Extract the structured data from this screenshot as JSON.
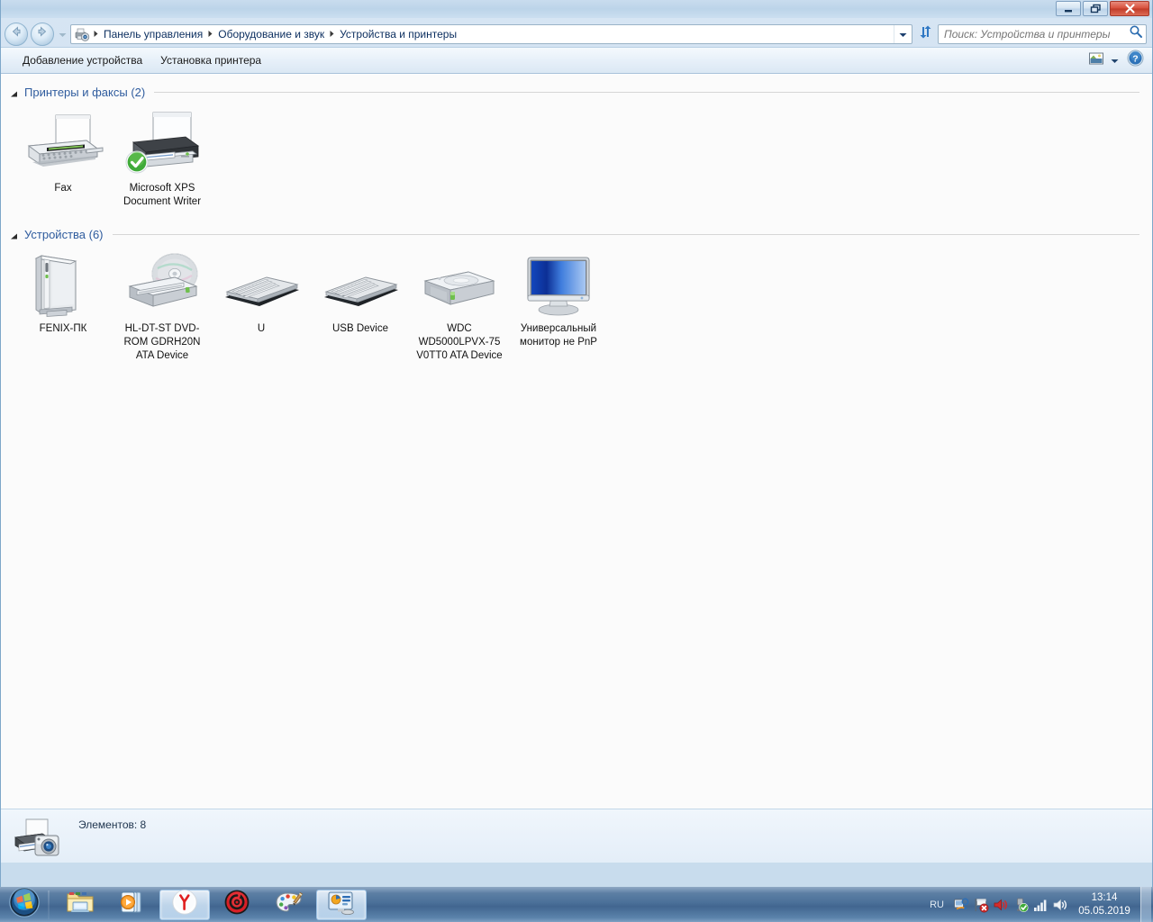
{
  "window": {
    "buttons": {
      "minimize": "minimize-button",
      "restore": "restore-button",
      "close": "close-button"
    }
  },
  "address_bar": {
    "breadcrumbs": [
      "Панель управления",
      "Оборудование и звук",
      "Устройства и принтеры"
    ],
    "separator": "▸",
    "icon": "devices-and-printers-icon",
    "dropdown_icon": "chevron-down-icon",
    "refresh_icon": "refresh-icon",
    "back_icon": "back-arrow-icon",
    "forward_icon": "forward-arrow-icon",
    "history_caret_icon": "chevron-down-icon"
  },
  "search": {
    "placeholder": "Поиск: Устройства и принтеры",
    "value": "",
    "icon": "search-icon"
  },
  "toolbar": {
    "items": [
      {
        "label": "Добавление устройства",
        "name": "add-device-button"
      },
      {
        "label": "Установка принтера",
        "name": "add-printer-button"
      }
    ],
    "view_icon": "view-options-icon",
    "view_caret_icon": "chevron-down-icon",
    "help_icon": "help-icon"
  },
  "groups": [
    {
      "title": "Принтеры и факсы (2)",
      "name": "group-printers-and-faxes",
      "collapse_icon": "triangle-collapse-icon",
      "items": [
        {
          "label": "Fax",
          "icon": "fax-machine-icon",
          "name": "device-tile-fax",
          "default": false
        },
        {
          "label": "Microsoft XPS Document Writer",
          "icon": "printer-icon",
          "name": "device-tile-xps-writer",
          "default": true,
          "badge": "default-printer-check-icon"
        }
      ]
    },
    {
      "title": "Устройства (6)",
      "name": "group-devices",
      "collapse_icon": "triangle-collapse-icon",
      "items": [
        {
          "label": "FENIX-ПК",
          "icon": "desktop-computer-icon",
          "name": "device-tile-fenix-pc"
        },
        {
          "label": "HL-DT-ST DVD-ROM GDRH20N ATA Device",
          "icon": "dvd-drive-icon",
          "name": "device-tile-dvd-rom"
        },
        {
          "label": "U",
          "icon": "keyboard-icon",
          "name": "device-tile-u"
        },
        {
          "label": "USB Device",
          "icon": "keyboard-icon",
          "name": "device-tile-usb-device"
        },
        {
          "label": "WDC WD5000LPVX-75 V0TT0 ATA Device",
          "icon": "hard-disk-icon",
          "name": "device-tile-wdc-disk"
        },
        {
          "label": "Универсальный монитор не PnP",
          "icon": "monitor-icon",
          "name": "device-tile-monitor"
        }
      ]
    }
  ],
  "status_bar": {
    "text": "Элементов: 8",
    "icon": "devices-and-printers-icon"
  },
  "taskbar": {
    "start_icon": "windows-start-orb-icon",
    "tasks": [
      {
        "name": "taskbar-explorer",
        "icon": "folder-explorer-icon",
        "active": false
      },
      {
        "name": "taskbar-media-player",
        "icon": "media-player-icon",
        "active": false
      },
      {
        "name": "taskbar-yandex-browser",
        "icon": "yandex-browser-icon",
        "active": true
      },
      {
        "name": "taskbar-antivirus",
        "icon": "red-shield-icon",
        "active": false
      },
      {
        "name": "taskbar-paint",
        "icon": "paint-palette-icon",
        "active": false
      },
      {
        "name": "taskbar-devices-printers",
        "icon": "devices-and-printers-icon",
        "active": true
      }
    ],
    "tray": {
      "language": "RU",
      "icons": [
        "network-sync-icon",
        "action-center-flag-icon",
        "volume-muted-icon",
        "usb-safely-remove-icon",
        "network-signal-icon",
        "volume-icon"
      ],
      "time": "13:14",
      "date": "05.05.2019"
    },
    "show_desktop": "show-desktop-button"
  },
  "colors": {
    "accent": "#2f5c9e",
    "content_bg": "#fbfbfb",
    "chrome": "#cfe0f0",
    "close_red": "#c03c29"
  }
}
